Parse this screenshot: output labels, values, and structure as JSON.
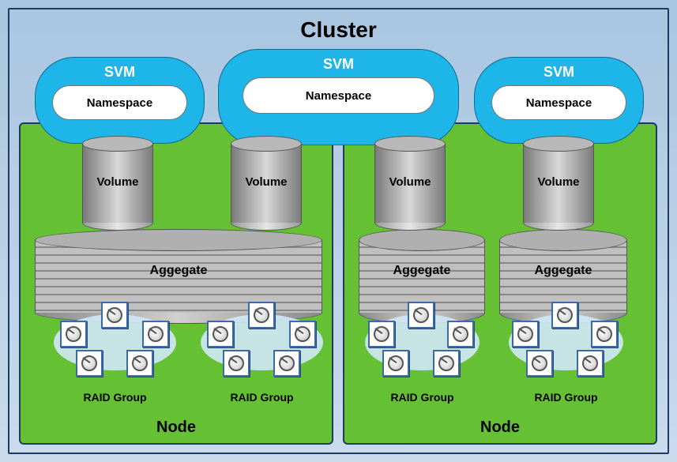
{
  "cluster_title": "Cluster",
  "svms": [
    {
      "label": "SVM",
      "namespace": "Namespace"
    },
    {
      "label": "SVM",
      "namespace": "Namespace"
    },
    {
      "label": "SVM",
      "namespace": "Namespace"
    }
  ],
  "volumes": [
    {
      "label": "Volume"
    },
    {
      "label": "Volume"
    },
    {
      "label": "Volume"
    },
    {
      "label": "Volume"
    }
  ],
  "aggregates": [
    {
      "label": "Aggegate"
    },
    {
      "label": "Aggegate"
    },
    {
      "label": "Aggegate"
    }
  ],
  "raid_groups": [
    {
      "label": "RAID Group",
      "disk_count": 5
    },
    {
      "label": "RAID Group",
      "disk_count": 5
    },
    {
      "label": "RAID Group",
      "disk_count": 5
    },
    {
      "label": "RAID Group",
      "disk_count": 5
    }
  ],
  "nodes": [
    {
      "label": "Node"
    },
    {
      "label": "Node"
    }
  ]
}
